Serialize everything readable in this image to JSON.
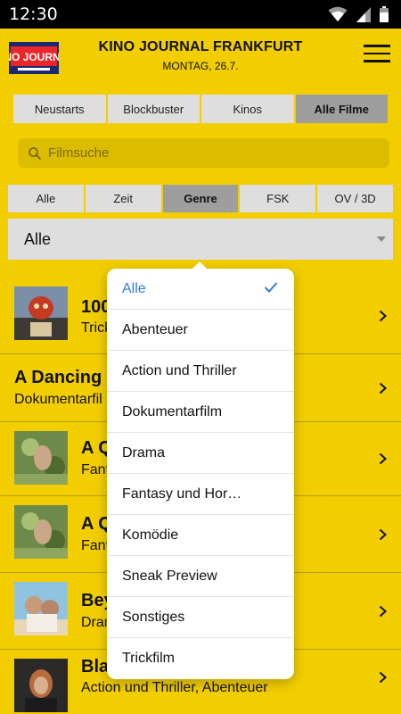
{
  "status_bar": {
    "time": "12:30",
    "icons": [
      "wifi-icon",
      "signal-icon",
      "battery-icon"
    ]
  },
  "header": {
    "logo_text": "KINO JOURNAL",
    "title": "KINO JOURNAL FRANKFURT",
    "date": "MONTAG, 26.7."
  },
  "tabs": [
    {
      "label": "Neustarts"
    },
    {
      "label": "Blockbuster"
    },
    {
      "label": "Kinos"
    },
    {
      "label": "Alle Filme"
    }
  ],
  "search": {
    "placeholder": "Filmsuche"
  },
  "filter_tabs": [
    {
      "label": "Alle"
    },
    {
      "label": "Zeit"
    },
    {
      "label": "Genre"
    },
    {
      "label": "FSK"
    },
    {
      "label": "OV / 3D"
    }
  ],
  "genre_select": {
    "value": "Alle"
  },
  "movies": [
    {
      "title": "100",
      "genre": "Trick"
    },
    {
      "title": "A Dancing",
      "genre": "Dokumentarfil"
    },
    {
      "title": "A Q",
      "genre": "Fant"
    },
    {
      "title": "A Q",
      "genre": "Fant"
    },
    {
      "title": "Bey",
      "genre": "Dran"
    },
    {
      "title": "Black Widow",
      "genre": "Action und Thriller, Abenteuer"
    }
  ],
  "dropdown": {
    "options": [
      {
        "label": "Alle"
      },
      {
        "label": "Abenteuer"
      },
      {
        "label": "Action und Thriller"
      },
      {
        "label": "Dokumentarfilm"
      },
      {
        "label": "Drama"
      },
      {
        "label": "Fantasy und Hor…"
      },
      {
        "label": "Komödie"
      },
      {
        "label": "Sneak Preview"
      },
      {
        "label": "Sonstiges"
      },
      {
        "label": "Trickfilm"
      }
    ]
  },
  "colors": {
    "background": "#F2CE00",
    "tab_active": "#9E9E9E",
    "tab_inactive": "#DEDEDE",
    "selected_option": "#2F7AE5"
  }
}
